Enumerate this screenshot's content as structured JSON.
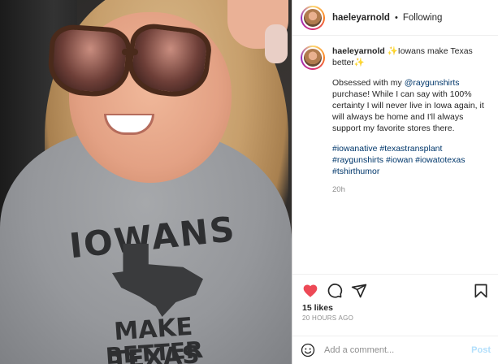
{
  "photo": {
    "shirt_line1": "IOWANS",
    "shirt_line2": "MAKE TEXAS",
    "shirt_line3": "BETTER"
  },
  "header": {
    "username": "haeleyarnold",
    "separator": "•",
    "follow_status": "Following"
  },
  "caption": {
    "username": "haeleyarnold",
    "title": "✨Iowans make Texas better✨",
    "body_before_mention": "Obsessed with my ",
    "mention": "@raygunshirts",
    "body_after_mention": " purchase! While I can say with 100% certainty I will never live in Iowa again, it will always be home and I'll always support my favorite stores there.",
    "hashtags": [
      "#iowanative",
      "#texastransplant",
      "#raygunshirts",
      "#iowan",
      "#iowatotexas",
      "#tshirthumor"
    ],
    "time": "20h"
  },
  "actions": {
    "like_icon": "heart-filled-icon",
    "comment_icon": "comment-icon",
    "share_icon": "paper-plane-icon",
    "save_icon": "bookmark-icon",
    "heart_color": "#ed4956"
  },
  "stats": {
    "likes": "15 likes",
    "posted_ago": "20 HOURS AGO"
  },
  "comment": {
    "emoji_icon": "emoji-smile-icon",
    "placeholder": "Add a comment...",
    "post_label": "Post"
  }
}
